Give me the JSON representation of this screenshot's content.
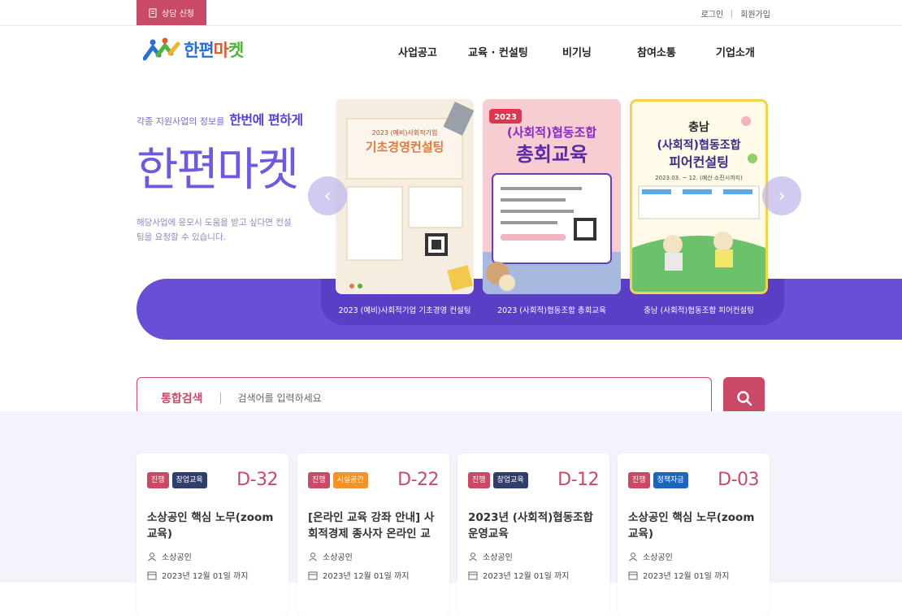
{
  "topbar": {
    "consult_label": "상담 신청",
    "login": "로그인",
    "signup": "회원가입"
  },
  "header": {
    "logo": {
      "part1": "한편",
      "part2": "마",
      "part3": "켓"
    },
    "nav": [
      "사업공고",
      "교육 · 컨설팅",
      "비기닝",
      "참여소통",
      "기업소개"
    ]
  },
  "hero": {
    "tagline_small": "각종 지원사업의 정보를",
    "tagline_strong": "한번에 편하게",
    "title": "한편마켓",
    "desc": "해당사업에 응모시 도움을 받고 싶다면 컨설팅을 요청할 수 있습니다.",
    "slides": [
      {
        "caption": "2023 (예비)사회적기업 기초경영 컨설팅",
        "poster_year": "2023 (예비)사회적기업",
        "poster_title": "기초경영컨설팅"
      },
      {
        "caption": "2023 (사회적)협동조합 총회교육",
        "poster_year": "2023",
        "poster_title1": "(사회적)협동조합",
        "poster_title2": "총회교육"
      },
      {
        "caption": "충남 (사회적)협동조합 피어컨설팅",
        "poster_header": "충남",
        "poster_title1": "(사회적)협동조합",
        "poster_title2": "피어컨설팅",
        "poster_date": "2023.03. ~ 12. (예산 소진시까지)"
      }
    ]
  },
  "search": {
    "label": "통합검색",
    "placeholder": "검색어를 입력하세요"
  },
  "cards": [
    {
      "status": "진행",
      "category": "창업교육",
      "category_color": "#2f3e6b",
      "dday": "D-32",
      "title": "소상공인 핵심 노무(zoom 교육)",
      "target": "소상공인",
      "deadline": "2023년 12월 01일 까지"
    },
    {
      "status": "진행",
      "category": "시설공간",
      "category_color": "#f0932b",
      "dday": "D-22",
      "title": "[온라인 교육 강좌 안내] 사회적경제 종사자 온라인 교육..",
      "target": "소상공인",
      "deadline": "2023년 12월 01일 까지"
    },
    {
      "status": "진행",
      "category": "창업교육",
      "category_color": "#2f3e6b",
      "dday": "D-12",
      "title": "2023년 (사회적)협동조합 운영교육",
      "target": "소상공인",
      "deadline": "2023년 12월 01일 까지"
    },
    {
      "status": "진행",
      "category": "정책자금",
      "category_color": "#1f66b8",
      "dday": "D-03",
      "title": "소상공인 핵심 노무(zoom 교육)",
      "target": "소상공인",
      "deadline": "2023년 12월 01일 까지"
    }
  ],
  "colors": {
    "accent": "#c94a66",
    "purple": "#6a4fd6"
  }
}
